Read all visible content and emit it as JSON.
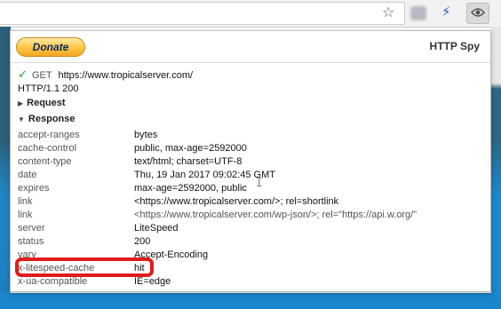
{
  "browser": {
    "star_icon": "star-icon",
    "extension_icons": [
      "blurred-extension-icon",
      "bolt-icon",
      "eye-icon"
    ]
  },
  "popup": {
    "donate_label": "Donate",
    "title": "HTTP Spy",
    "request_line": {
      "method": "GET",
      "url": "https://www.tropicalserver.com/"
    },
    "status_line": "HTTP/1.1 200",
    "sections": {
      "request": "Request",
      "response": "Response"
    },
    "response_headers": [
      {
        "key": "accept-ranges",
        "value": "bytes"
      },
      {
        "key": "cache-control",
        "value": "public, max-age=2592000"
      },
      {
        "key": "content-type",
        "value": "text/html; charset=UTF-8"
      },
      {
        "key": "date",
        "value": "Thu, 19 Jan 2017 09:02:45 GMT"
      },
      {
        "key": "expires",
        "value": "max-age=2592000, public"
      },
      {
        "key": "link",
        "value": "<https://www.tropicalserver.com/>; rel=shortlink"
      },
      {
        "key": "link",
        "value": "<https://www.tropicalserver.com/wp-json/>; rel=\"https://api.w.org/\""
      },
      {
        "key": "server",
        "value": "LiteSpeed"
      },
      {
        "key": "status",
        "value": "200"
      },
      {
        "key": "vary",
        "value": "Accept-Encoding"
      },
      {
        "key": "x-litespeed-cache",
        "value": "hit"
      },
      {
        "key": "x-ua-compatible",
        "value": "IE=edge"
      }
    ]
  },
  "colors": {
    "check_green": "#1c9c2c",
    "highlight_red": "#e21b1b",
    "donate_gold": "#ffc94a",
    "page_blue": "#1a86cc"
  }
}
